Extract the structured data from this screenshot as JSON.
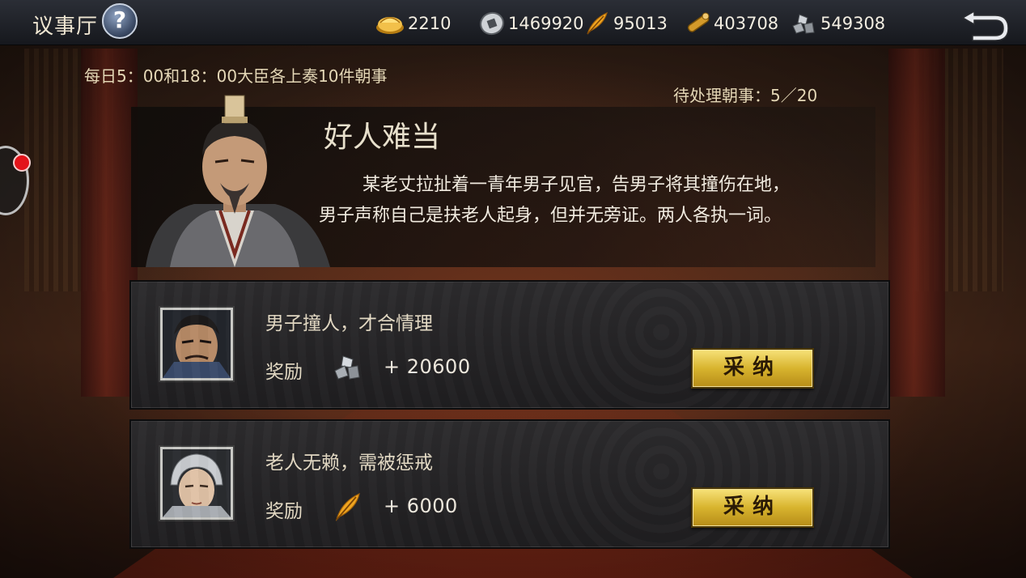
{
  "header": {
    "title": "议事厅",
    "help_label": "?",
    "resources": {
      "gold": "2210",
      "silver": "1469920",
      "feather": "95013",
      "timber": "403708",
      "stone": "549308"
    }
  },
  "info": {
    "daily_note": "每日5：00和18：00大臣各上奏10件朝事",
    "pending": "待处理朝事：5／20"
  },
  "event": {
    "title": "好人难当",
    "desc_line1": "某老丈拉扯着一青年男子见官，告男子将其撞伤在地，",
    "desc_line2": "男子声称自己是扶老人起身，但并无旁证。两人各执一词。"
  },
  "options": [
    {
      "text": "男子撞人，才合情理",
      "reward_label": "奖励",
      "reward_icon": "stone-icon",
      "reward_amount": "+ 20600",
      "button": "采纳"
    },
    {
      "text": "老人无赖，需被惩戒",
      "reward_label": "奖励",
      "reward_icon": "feather-icon",
      "reward_amount": "+ 6000",
      "button": "采纳"
    }
  ],
  "colors": {
    "button_gold": "#d8b42e",
    "panel": "#2c2b2d",
    "notification": "#e3141a"
  }
}
